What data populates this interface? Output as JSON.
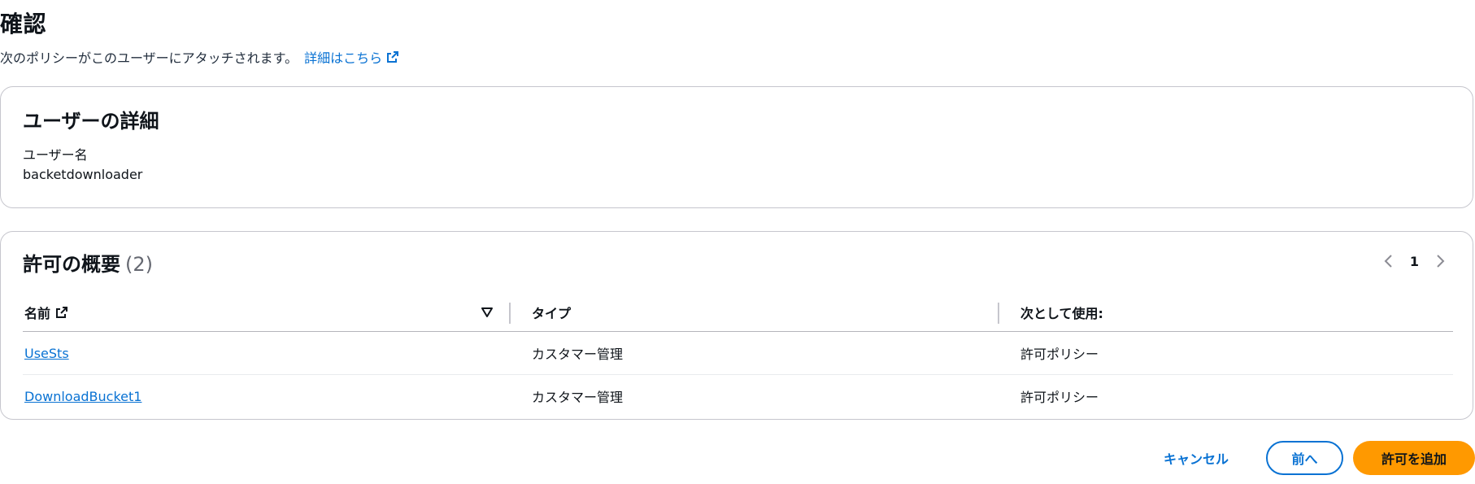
{
  "header": {
    "title": "確認",
    "description": "次のポリシーがこのユーザーにアタッチされます。",
    "learn_more": "詳細はこちら"
  },
  "user_details": {
    "title": "ユーザーの詳細",
    "username_label": "ユーザー名",
    "username_value": "backetdownloader"
  },
  "permissions": {
    "title": "許可の概要",
    "count": "(2)",
    "pagination": {
      "current_page": "1"
    },
    "columns": {
      "name": "名前",
      "type": "タイプ",
      "used_as": "次として使用:"
    },
    "rows": [
      {
        "name": "UseSts",
        "type": "カスタマー管理",
        "used_as": "許可ポリシー"
      },
      {
        "name": "DownloadBucket1",
        "type": "カスタマー管理",
        "used_as": "許可ポリシー"
      }
    ]
  },
  "actions": {
    "cancel": "キャンセル",
    "previous": "前へ",
    "add_permissions": "許可を追加"
  },
  "colors": {
    "link": "#0972d3",
    "primary_button": "#ff9900",
    "border": "#c6c6cd"
  },
  "icons": [
    "external-link-icon",
    "sort-caret-down-icon",
    "chevron-left-icon",
    "chevron-right-icon"
  ]
}
